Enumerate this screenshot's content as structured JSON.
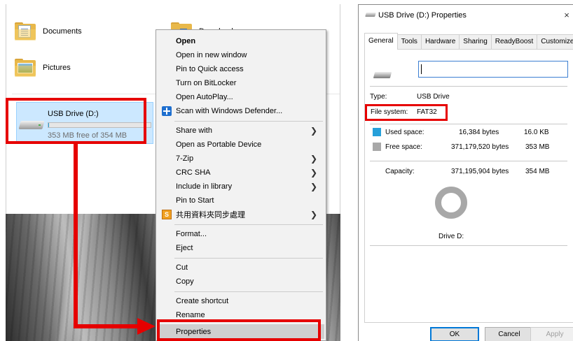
{
  "explorer": {
    "folders": [
      {
        "name": "Documents",
        "icon": "documents-folder-icon"
      },
      {
        "name": "Downloads",
        "icon": "downloads-folder-icon"
      },
      {
        "name": "Pictures",
        "icon": "pictures-folder-icon"
      }
    ],
    "drive": {
      "name": "USB Drive (D:)",
      "free_text": "353 MB free of 354 MB",
      "used_fraction": 0.003,
      "icon": "usb-drive-icon"
    }
  },
  "context_menu": {
    "items": [
      {
        "label": "Open"
      },
      {
        "label": "Open in new window"
      },
      {
        "label": "Pin to Quick access"
      },
      {
        "label": "Turn on BitLocker"
      },
      {
        "label": "Open AutoPlay..."
      },
      {
        "label": "Scan with Windows Defender..."
      },
      {
        "label": "Share with"
      },
      {
        "label": "Open as Portable Device"
      },
      {
        "label": "7-Zip"
      },
      {
        "label": "CRC SHA"
      },
      {
        "label": "Include in library"
      },
      {
        "label": "Pin to Start"
      },
      {
        "label": "共用資料夾同步處理"
      },
      {
        "label": "Format..."
      },
      {
        "label": "Eject"
      },
      {
        "label": "Cut"
      },
      {
        "label": "Copy"
      },
      {
        "label": "Create shortcut"
      },
      {
        "label": "Rename"
      },
      {
        "label": "Properties"
      }
    ],
    "icons": {
      "scan": "windows-defender-shield-icon",
      "sync": "sync-folder-icon",
      "submenu": "chevron-right-icon"
    }
  },
  "dialog": {
    "title": "USB Drive (D:) Properties",
    "close": "×",
    "tabs": [
      "General",
      "Tools",
      "Hardware",
      "Sharing",
      "ReadyBoost",
      "Customize"
    ],
    "label_value": "",
    "type_label": "Type:",
    "type_value": "USB Drive",
    "fs_label": "File system:",
    "fs_value": "FAT32",
    "used_label": "Used space:",
    "used_bytes": "16,384 bytes",
    "used_short": "16.0 KB",
    "free_label": "Free space:",
    "free_bytes": "371,179,520 bytes",
    "free_short": "353 MB",
    "cap_label": "Capacity:",
    "cap_bytes": "371,195,904 bytes",
    "cap_short": "354 MB",
    "drive_caption": "Drive D:",
    "colors": {
      "used": "#26a0da",
      "free": "#a8a8a8",
      "highlight": "#e60000"
    },
    "buttons": {
      "ok": "OK",
      "cancel": "Cancel",
      "apply": "Apply"
    }
  }
}
